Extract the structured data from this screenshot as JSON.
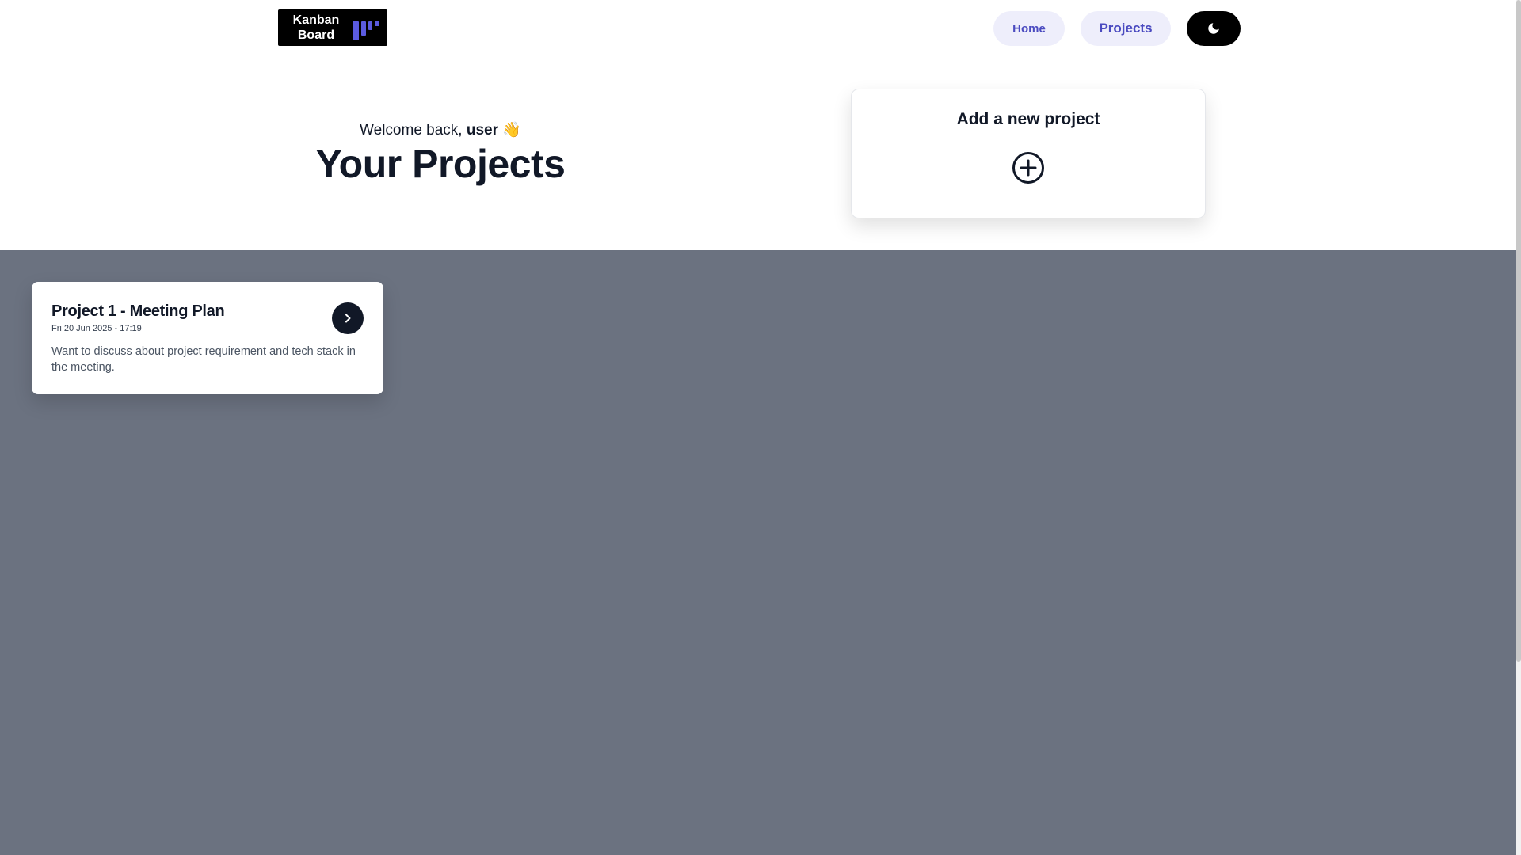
{
  "header": {
    "logo": {
      "line1": "Kanban",
      "line2": "Board"
    },
    "nav": {
      "home_label": "Home",
      "projects_label": "Projects"
    },
    "theme_toggle_icon": "moon-icon"
  },
  "hero": {
    "welcome_prefix": "Welcome back, ",
    "username": "user",
    "wave_emoji": "👋",
    "title": "Your Projects"
  },
  "add_project": {
    "label": "Add a new project",
    "icon": "plus-circle-icon"
  },
  "projects": [
    {
      "title": "Project 1 - Meeting Plan",
      "date": "Fri 20 Jun 2025 - 17:19",
      "description": "Want to discuss about project requirement and tech stack in the meeting.",
      "open_icon": "chevron-right-icon"
    }
  ],
  "colors": {
    "accent": "#4b4bc0",
    "logo_bars": "#5b5be0",
    "nav_pill_bg": "#eeeefb",
    "section_bg": "#6b7280",
    "dark": "#111827"
  }
}
